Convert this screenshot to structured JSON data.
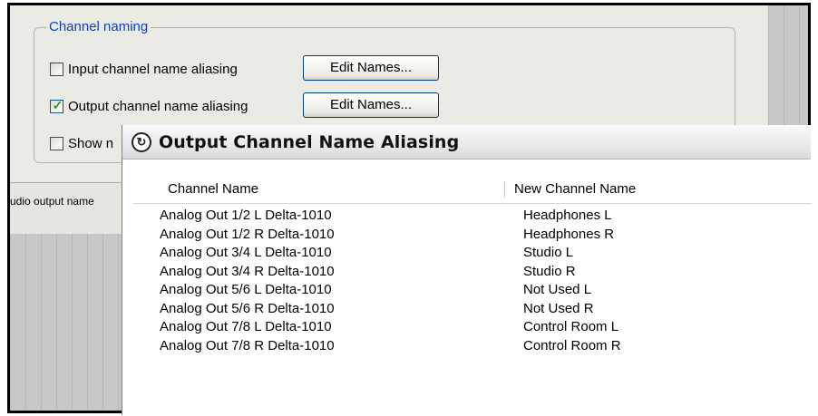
{
  "background_panel": {
    "group_title": "Channel naming",
    "input_aliasing_label": "Input channel name aliasing",
    "input_aliasing_checked": false,
    "input_edit_button": "Edit Names...",
    "output_aliasing_label": "Output channel name aliasing",
    "output_aliasing_checked": true,
    "output_edit_button": "Edit Names...",
    "show_label_partial": "Show n",
    "show_checked": false,
    "audio_output_label": "udio output name"
  },
  "dialog": {
    "title": "Output Channel Name Aliasing",
    "app_icon": "reaper-logo-icon",
    "columns": [
      "Channel Name",
      "New Channel Name"
    ],
    "rows": [
      [
        "Analog Out 1/2 L Delta-1010",
        "Headphones L"
      ],
      [
        "Analog Out 1/2 R Delta-1010",
        "Headphones R"
      ],
      [
        "Analog Out 3/4 L Delta-1010",
        "Studio L"
      ],
      [
        "Analog Out 3/4 R Delta-1010",
        "Studio R"
      ],
      [
        "Analog Out 5/6 L Delta-1010",
        "Not Used L"
      ],
      [
        "Analog Out 5/6 R Delta-1010",
        "Not Used R"
      ],
      [
        "Analog Out 7/8 L Delta-1010",
        "Control Room L"
      ],
      [
        "Analog Out 7/8 R Delta-1010",
        "Control Room R"
      ]
    ]
  },
  "colors": {
    "group_title": "#0a3fc8",
    "checkmark": "#21a121",
    "button_border": "#003c74"
  }
}
